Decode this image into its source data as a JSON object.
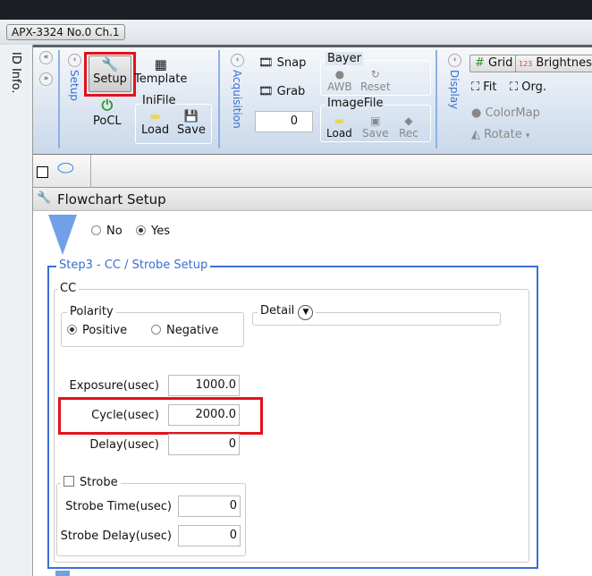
{
  "window": {
    "doc_tab": "APX-3324 No.0 Ch.1",
    "side_label": "ID Info."
  },
  "ribbon": {
    "setup": {
      "group": "Setup",
      "setup_btn": "Setup",
      "template_btn": "Template",
      "pocl_btn": "PoCL",
      "inifile": {
        "title": "IniFile",
        "load": "Load",
        "save": "Save"
      }
    },
    "acquisition": {
      "group": "Acquisition",
      "snap": "Snap",
      "grab": "Grab",
      "counter": "0",
      "bayer": {
        "title": "Bayer",
        "awb": "AWB",
        "reset": "Reset"
      },
      "imagefile": {
        "title": "ImageFile",
        "load": "Load",
        "save": "Save",
        "rec": "Rec"
      }
    },
    "display": {
      "group": "Display",
      "grid": "Grid",
      "brightness": "Brightness",
      "brightness_icon": "123",
      "fit": "Fit",
      "org": "Org.",
      "colormap": "ColorMap",
      "rotate": "Rotate"
    }
  },
  "panel": {
    "title": "Flowchart Setup",
    "choice": {
      "no": "No",
      "yes": "Yes",
      "selected": "Yes"
    },
    "step": "Step3 - CC / Strobe Setup",
    "cc": {
      "title": "CC",
      "polarity": {
        "title": "Polarity",
        "positive": "Positive",
        "negative": "Negative",
        "selected": "Positive"
      },
      "detail": "Detail",
      "fields": [
        {
          "label": "Exposure(usec)",
          "value": "1000.0"
        },
        {
          "label": "Cycle(usec)",
          "value": "2000.0"
        },
        {
          "label": "Delay(usec)",
          "value": "0"
        }
      ]
    },
    "strobe": {
      "title": "Strobe",
      "checked": false,
      "fields": [
        {
          "label": "Strobe Time(usec)",
          "value": "0"
        },
        {
          "label": "Strobe Delay(usec)",
          "value": "0"
        }
      ]
    }
  },
  "colors": {
    "highlight": "#e3121b",
    "accent": "#3a6fd0",
    "group_border": "#3b6fd8"
  }
}
